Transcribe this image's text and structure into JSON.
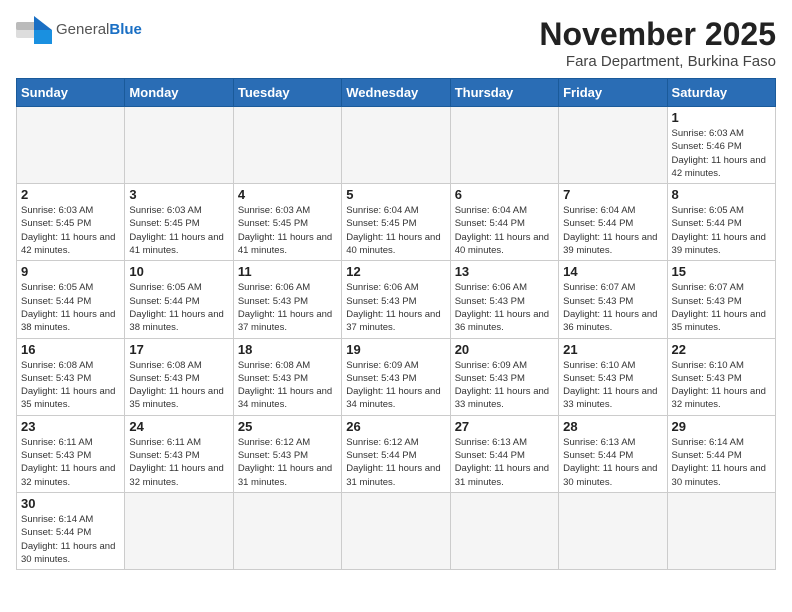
{
  "header": {
    "logo_general": "General",
    "logo_blue": "Blue",
    "month_title": "November 2025",
    "location": "Fara Department, Burkina Faso"
  },
  "weekdays": [
    "Sunday",
    "Monday",
    "Tuesday",
    "Wednesday",
    "Thursday",
    "Friday",
    "Saturday"
  ],
  "weeks": [
    [
      {
        "day": "",
        "empty": true
      },
      {
        "day": "",
        "empty": true
      },
      {
        "day": "",
        "empty": true
      },
      {
        "day": "",
        "empty": true
      },
      {
        "day": "",
        "empty": true
      },
      {
        "day": "",
        "empty": true
      },
      {
        "day": "1",
        "sunrise": "6:03 AM",
        "sunset": "5:46 PM",
        "daylight": "11 hours and 42 minutes."
      }
    ],
    [
      {
        "day": "2",
        "sunrise": "6:03 AM",
        "sunset": "5:45 PM",
        "daylight": "11 hours and 42 minutes."
      },
      {
        "day": "3",
        "sunrise": "6:03 AM",
        "sunset": "5:45 PM",
        "daylight": "11 hours and 41 minutes."
      },
      {
        "day": "4",
        "sunrise": "6:03 AM",
        "sunset": "5:45 PM",
        "daylight": "11 hours and 41 minutes."
      },
      {
        "day": "5",
        "sunrise": "6:04 AM",
        "sunset": "5:45 PM",
        "daylight": "11 hours and 40 minutes."
      },
      {
        "day": "6",
        "sunrise": "6:04 AM",
        "sunset": "5:44 PM",
        "daylight": "11 hours and 40 minutes."
      },
      {
        "day": "7",
        "sunrise": "6:04 AM",
        "sunset": "5:44 PM",
        "daylight": "11 hours and 39 minutes."
      },
      {
        "day": "8",
        "sunrise": "6:05 AM",
        "sunset": "5:44 PM",
        "daylight": "11 hours and 39 minutes."
      }
    ],
    [
      {
        "day": "9",
        "sunrise": "6:05 AM",
        "sunset": "5:44 PM",
        "daylight": "11 hours and 38 minutes."
      },
      {
        "day": "10",
        "sunrise": "6:05 AM",
        "sunset": "5:44 PM",
        "daylight": "11 hours and 38 minutes."
      },
      {
        "day": "11",
        "sunrise": "6:06 AM",
        "sunset": "5:43 PM",
        "daylight": "11 hours and 37 minutes."
      },
      {
        "day": "12",
        "sunrise": "6:06 AM",
        "sunset": "5:43 PM",
        "daylight": "11 hours and 37 minutes."
      },
      {
        "day": "13",
        "sunrise": "6:06 AM",
        "sunset": "5:43 PM",
        "daylight": "11 hours and 36 minutes."
      },
      {
        "day": "14",
        "sunrise": "6:07 AM",
        "sunset": "5:43 PM",
        "daylight": "11 hours and 36 minutes."
      },
      {
        "day": "15",
        "sunrise": "6:07 AM",
        "sunset": "5:43 PM",
        "daylight": "11 hours and 35 minutes."
      }
    ],
    [
      {
        "day": "16",
        "sunrise": "6:08 AM",
        "sunset": "5:43 PM",
        "daylight": "11 hours and 35 minutes."
      },
      {
        "day": "17",
        "sunrise": "6:08 AM",
        "sunset": "5:43 PM",
        "daylight": "11 hours and 35 minutes."
      },
      {
        "day": "18",
        "sunrise": "6:08 AM",
        "sunset": "5:43 PM",
        "daylight": "11 hours and 34 minutes."
      },
      {
        "day": "19",
        "sunrise": "6:09 AM",
        "sunset": "5:43 PM",
        "daylight": "11 hours and 34 minutes."
      },
      {
        "day": "20",
        "sunrise": "6:09 AM",
        "sunset": "5:43 PM",
        "daylight": "11 hours and 33 minutes."
      },
      {
        "day": "21",
        "sunrise": "6:10 AM",
        "sunset": "5:43 PM",
        "daylight": "11 hours and 33 minutes."
      },
      {
        "day": "22",
        "sunrise": "6:10 AM",
        "sunset": "5:43 PM",
        "daylight": "11 hours and 32 minutes."
      }
    ],
    [
      {
        "day": "23",
        "sunrise": "6:11 AM",
        "sunset": "5:43 PM",
        "daylight": "11 hours and 32 minutes."
      },
      {
        "day": "24",
        "sunrise": "6:11 AM",
        "sunset": "5:43 PM",
        "daylight": "11 hours and 32 minutes."
      },
      {
        "day": "25",
        "sunrise": "6:12 AM",
        "sunset": "5:43 PM",
        "daylight": "11 hours and 31 minutes."
      },
      {
        "day": "26",
        "sunrise": "6:12 AM",
        "sunset": "5:44 PM",
        "daylight": "11 hours and 31 minutes."
      },
      {
        "day": "27",
        "sunrise": "6:13 AM",
        "sunset": "5:44 PM",
        "daylight": "11 hours and 31 minutes."
      },
      {
        "day": "28",
        "sunrise": "6:13 AM",
        "sunset": "5:44 PM",
        "daylight": "11 hours and 30 minutes."
      },
      {
        "day": "29",
        "sunrise": "6:14 AM",
        "sunset": "5:44 PM",
        "daylight": "11 hours and 30 minutes."
      }
    ],
    [
      {
        "day": "30",
        "sunrise": "6:14 AM",
        "sunset": "5:44 PM",
        "daylight": "11 hours and 30 minutes."
      },
      {
        "day": "",
        "empty": true
      },
      {
        "day": "",
        "empty": true
      },
      {
        "day": "",
        "empty": true
      },
      {
        "day": "",
        "empty": true
      },
      {
        "day": "",
        "empty": true
      },
      {
        "day": "",
        "empty": true
      }
    ]
  ]
}
